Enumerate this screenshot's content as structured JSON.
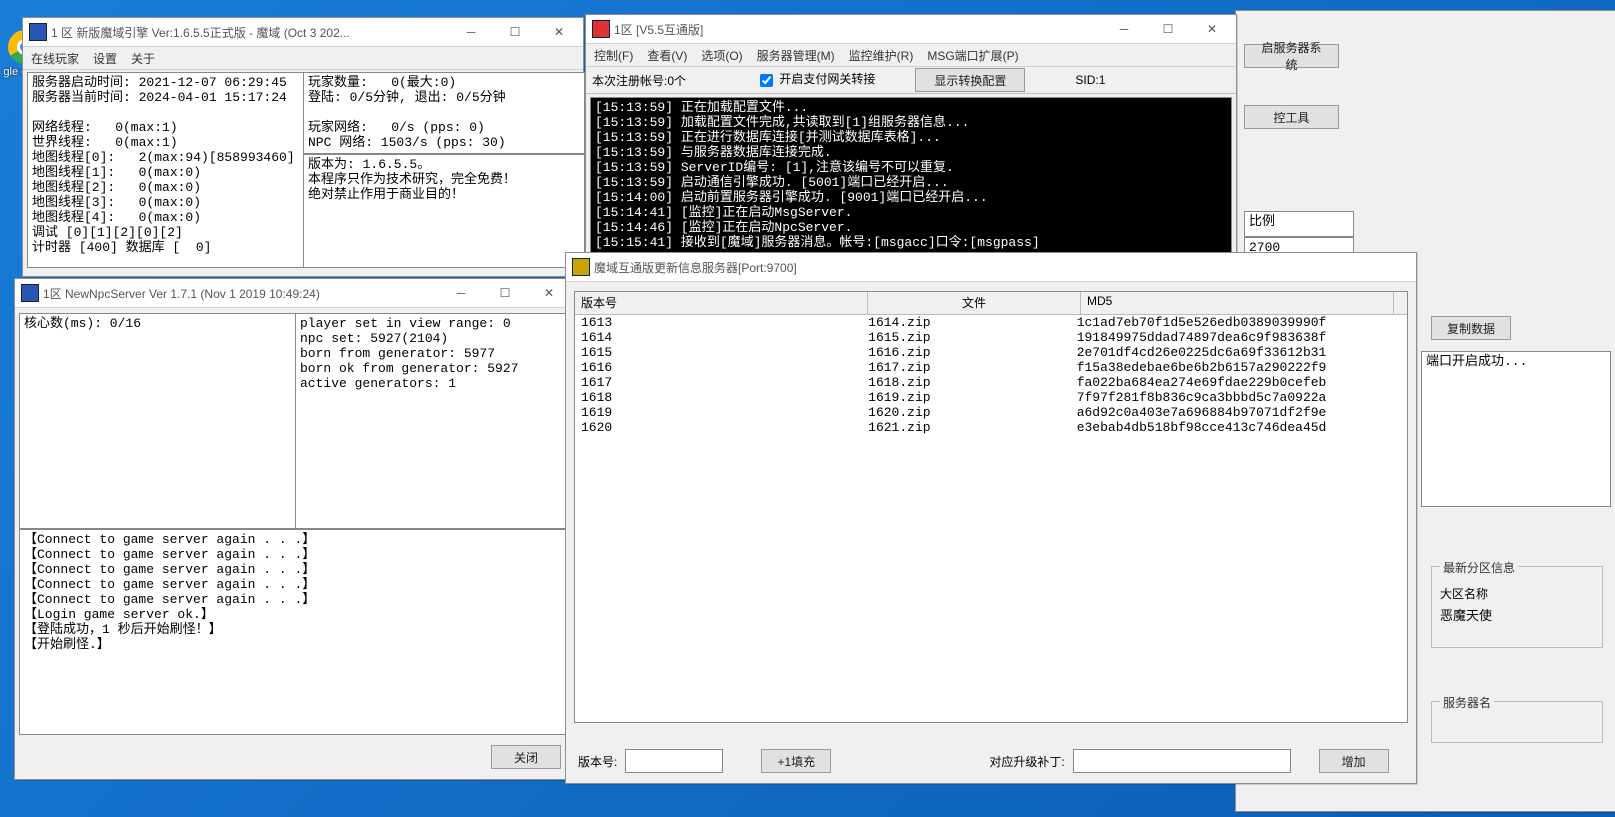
{
  "desktop": {
    "chrome_label": "gle\nom..."
  },
  "engine": {
    "title": "1 区 新版魔域引擎 Ver:1.6.5.5正式版 - 魔域 (Oct  3 202...",
    "menu": [
      "在线玩家",
      "设置",
      "关于"
    ],
    "left": [
      "服务器启动时间: 2021-12-07 06:29:45",
      "服务器当前时间: 2024-04-01 15:17:24",
      "",
      "网络线程:   0(max:1)",
      "世界线程:   0(max:1)",
      "地图线程[0]:   2(max:94)[858993460]",
      "地图线程[1]:   0(max:0)",
      "地图线程[2]:   0(max:0)",
      "地图线程[3]:   0(max:0)",
      "地图线程[4]:   0(max:0)",
      "调试 [0][1][2][0][2]",
      "计时器 [400] 数据库 [  0]"
    ],
    "right_top": [
      "玩家数量:   0(最大:0)",
      "登陆: 0/5分钟, 退出: 0/5分钟",
      "",
      "玩家网络:   0/s (pps: 0)",
      "NPC 网络: 1503/s (pps: 30)"
    ],
    "right_bot": [
      "版本为: 1.6.5.5。",
      "本程序只作为技术研究，完全免费！",
      "绝对禁止作用于商业目的！"
    ]
  },
  "interop": {
    "title": "1区 [V5.5互通版]",
    "menu": [
      "控制(F)",
      "查看(V)",
      "选项(O)",
      "服务器管理(M)",
      "监控维护(R)",
      "MSG端口扩展(P)"
    ],
    "reg_label": "本次注册帐号:0个",
    "gateway_check": "开启支付网关转接",
    "show_cfg_btn": "显示转换配置",
    "sid": "SID:1",
    "console": [
      "[15:13:59] 正在加载配置文件...",
      "[15:13:59] 加载配置文件完成,共读取到[1]组服务器信息...",
      "[15:13:59] 正在进行数据库连接[并测试数据库表格]...",
      "[15:13:59] 与服务器数据库连接完成.",
      "[15:13:59] ServerID编号: [1],注意该编号不可以重复.",
      "[15:13:59] 启动通信引擎成功. [5001]端口已经开启...",
      "[15:14:00] 启动前置服务器引擎成功. [9001]端口已经开启...",
      "[15:14:41] [监控]正在启动MsgServer.",
      "[15:14:46] [监控]正在启动NpcServer.",
      "[15:15:41] 接收到[魔域]服务器消息。帐号:[msgacc]口令:[msgpass]"
    ]
  },
  "npc": {
    "title": "1区 NewNpcServer Ver 1.7.1 (Nov  1 2019 10:49:24)",
    "cores": "核心数(ms): 0/16",
    "stats": [
      "player set in view range: 0",
      "npc set: 5927(2104)",
      "born from generator: 5977",
      "born ok from generator: 5927",
      "active generators: 1"
    ],
    "log": [
      "【Connect to game server again . . .】",
      "【Connect to game server again . . .】",
      "【Connect to game server again . . .】",
      "【Connect to game server again . . .】",
      "【Connect to game server again . . .】",
      "【Login game server ok.】",
      "【登陆成功，1 秒后开始刷怪！】",
      "【开始刷怪.】"
    ],
    "close_btn": "关闭"
  },
  "update": {
    "title": "魔域互通版更新信息服务器[Port:9700]",
    "cols": [
      "版本号",
      "文件",
      "MD5"
    ],
    "rows": [
      {
        "v": "1613",
        "f": "1614.zip",
        "m": "1c1ad7eb70f1d5e526edb0389039990f"
      },
      {
        "v": "1614",
        "f": "1615.zip",
        "m": "191849975ddad74897dea6c9f983638f"
      },
      {
        "v": "1615",
        "f": "1616.zip",
        "m": "2e701df4cd26e0225dc6a69f33612b31"
      },
      {
        "v": "1616",
        "f": "1617.zip",
        "m": "f15a38edebae6be6b2b6157a290222f9"
      },
      {
        "v": "1617",
        "f": "1618.zip",
        "m": "fa022ba684ea274e69fdae229b0cefeb"
      },
      {
        "v": "1618",
        "f": "1619.zip",
        "m": "7f97f281f8b836c9ca3bbbd5c7a0922a"
      },
      {
        "v": "1619",
        "f": "1620.zip",
        "m": "a6d92c0a403e7a696884b97071df2f9e"
      },
      {
        "v": "1620",
        "f": "1621.zip",
        "m": "e3ebab4db518bf98cce413c746dea45d"
      }
    ],
    "version_label": "版本号:",
    "plus1_btn": "+1填充",
    "patch_label": "对应升级补丁:",
    "add_btn": "增加"
  },
  "rightwin": {
    "start_server_btn": "启服务器系统",
    "watch_tool_btn": "控工具",
    "ratio_label": "比例",
    "ratio_value": "2700",
    "copy_data_btn": "复制数据",
    "port_msg": "端口开启成功...",
    "zone_group": "最新分区信息",
    "zone_label": "大区名称",
    "zone_value": "恶魔天使",
    "server_name_label": "服务器名"
  }
}
